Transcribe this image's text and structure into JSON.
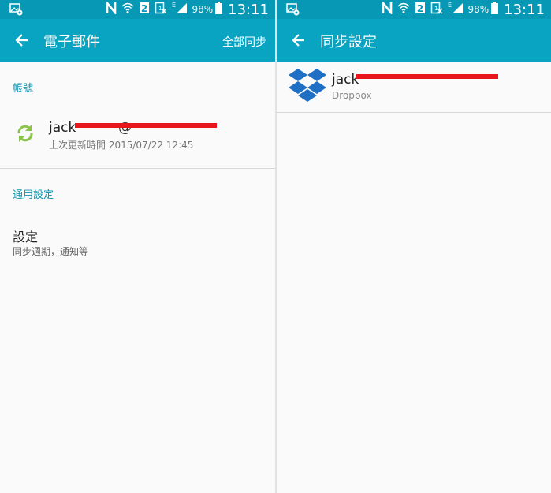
{
  "status_bar": {
    "network": "E",
    "sim": "2",
    "battery": "98%",
    "time": "13:11"
  },
  "left_screen": {
    "title": "電子郵件",
    "action": "全部同步",
    "section_accounts": "帳號",
    "account": {
      "email": "jack",
      "email_tail": "@",
      "last_update": "上次更新時間 2015/07/22 12:45"
    },
    "section_general": "通用設定",
    "settings": {
      "title": "設定",
      "subtitle": "同步週期，通知等"
    }
  },
  "right_screen": {
    "title": "同步設定",
    "account": {
      "email": "jack",
      "service": "Dropbox"
    }
  },
  "colors": {
    "appbar": "#0aa4c3",
    "statusbar": "#0798b6",
    "accent_text": "#1595ae",
    "sync_icon": "#8bc34a",
    "dropbox": "#1f6fc5",
    "redaction": "#e8161c"
  },
  "icons": [
    "gallery-icon",
    "nfc-icon",
    "wifi-icon",
    "sim-icon",
    "no-sim-icon",
    "signal-icon",
    "battery-icon",
    "back-arrow-icon",
    "sync-icon",
    "dropbox-icon"
  ]
}
